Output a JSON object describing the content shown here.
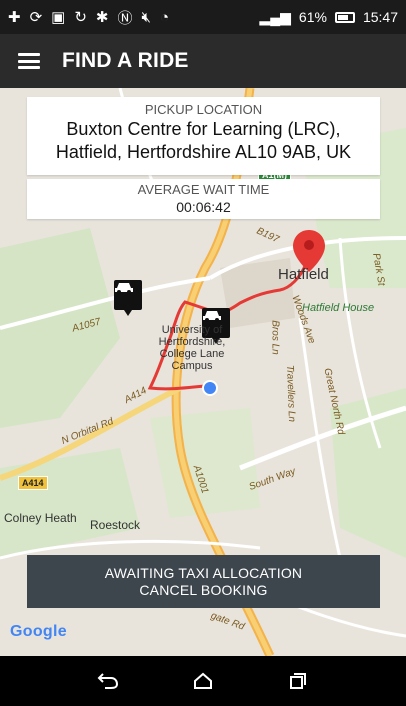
{
  "status_bar": {
    "battery": "61%",
    "time": "15:47"
  },
  "app_bar": {
    "title": "FIND A RIDE"
  },
  "pickup": {
    "label": "PICKUP LOCATION",
    "address_line1": "Buxton Centre for Learning (LRC),",
    "address_line2": "Hatfield, Hertfordshire AL10 9AB, UK"
  },
  "wait": {
    "label": "AVERAGE WAIT TIME",
    "value": "00:06:42"
  },
  "map": {
    "places": {
      "hatfield": "Hatfield",
      "hatfield_house": "Hatfield House",
      "colney_heath": "Colney Heath",
      "roestock": "Roestock",
      "university": "University of Hertfordshire, College Lane Campus"
    },
    "roads": {
      "north_orbital": "N Orbital Rd",
      "a414": "A414",
      "a1001": "A1001",
      "south_way": "South Way",
      "birds_ln": "Bros Ln",
      "a1057": "A1057",
      "b197": "B197",
      "park_st": "Park St",
      "great_north_rd": "Great North Rd",
      "woods_ave": "Woods Ave",
      "travellers_ln": "Travellers Ln",
      "a1m": "A1(M)",
      "gate_rd": "gate Rd"
    },
    "badges": {
      "a414": "A414",
      "a1m": "A1(M)"
    },
    "attribution": "Google",
    "route_color": "#e53935",
    "user_dot_color": "#4285f4",
    "pin_color": "#e53935"
  },
  "action": {
    "line1": "AWAITING TAXI ALLOCATION",
    "line2": "CANCEL BOOKING"
  },
  "nav": {
    "back_icon": "back-icon",
    "home_icon": "home-icon",
    "recents_icon": "recents-icon"
  }
}
